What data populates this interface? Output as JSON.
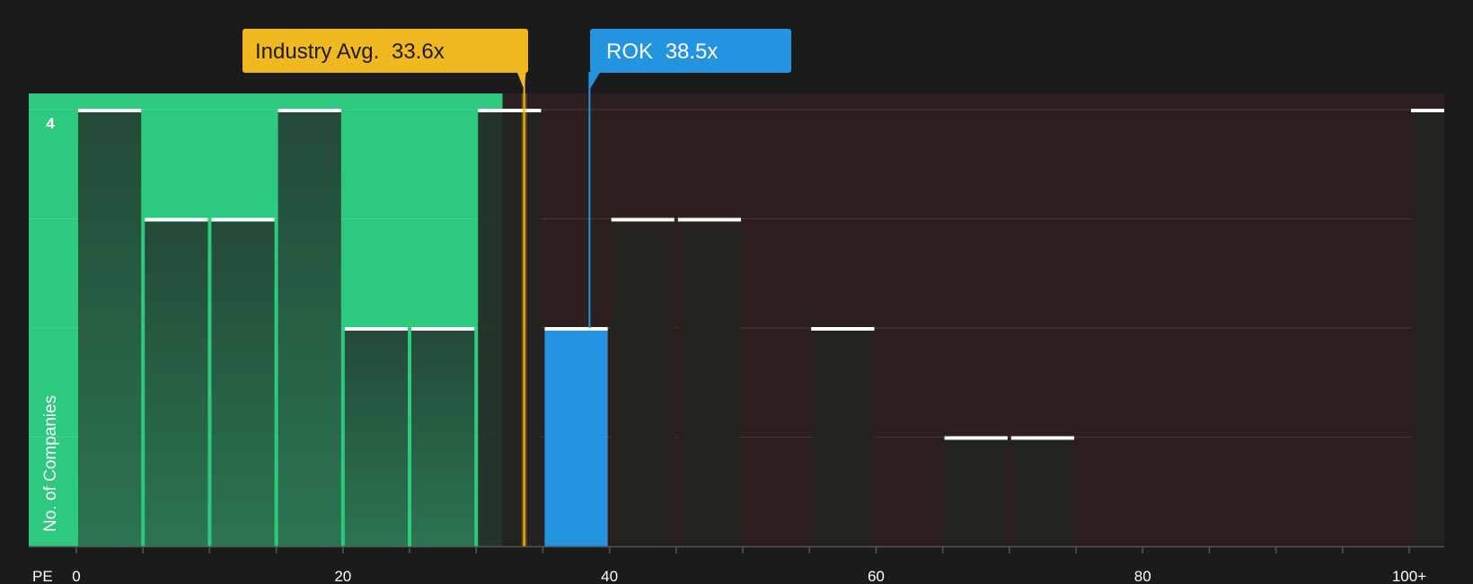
{
  "chart_data": {
    "type": "bar",
    "xlabel": "PE",
    "ylabel": "No. of Companies",
    "xlim": [
      0,
      100
    ],
    "ylim": [
      0,
      4
    ],
    "x_ticks": [
      0,
      20,
      40,
      60,
      80,
      100
    ],
    "x_tick_labels": [
      "0",
      "20",
      "40",
      "60",
      "80",
      "100+"
    ],
    "y_tick_labels": [
      {
        "value": 4,
        "label": "4"
      }
    ],
    "bin_width": 5,
    "bins": [
      {
        "x": 0,
        "count": 4
      },
      {
        "x": 5,
        "count": 3
      },
      {
        "x": 10,
        "count": 3
      },
      {
        "x": 15,
        "count": 4
      },
      {
        "x": 20,
        "count": 2
      },
      {
        "x": 25,
        "count": 2
      },
      {
        "x": 30,
        "count": 4
      },
      {
        "x": 35,
        "count": 2
      },
      {
        "x": 40,
        "count": 3
      },
      {
        "x": 45,
        "count": 3
      },
      {
        "x": 55,
        "count": 2
      },
      {
        "x": 65,
        "count": 1
      },
      {
        "x": 70,
        "count": 1
      },
      {
        "x": 100,
        "count": 4
      }
    ],
    "highlight_bin_x": 35,
    "industry_avg": {
      "label": "Industry Avg.",
      "value": 33.6,
      "value_label": "33.6x"
    },
    "company": {
      "label": "ROK",
      "value": 38.5,
      "value_label": "38.5x"
    },
    "grid": true,
    "colors": {
      "background": "#1b1b1b",
      "undervalued_region": "#2dc97e",
      "overvalued_region": "#2d1e1f",
      "bar_dark": "#23241f",
      "bar_green_top": "#234a37",
      "bar_green_bottom": "#2b7452",
      "bar_highlight": "#2394e0",
      "bar_cap": "#ffffff",
      "industry_callout": "#f0b81e",
      "company_callout": "#2394e0",
      "axis": "#555555"
    }
  }
}
